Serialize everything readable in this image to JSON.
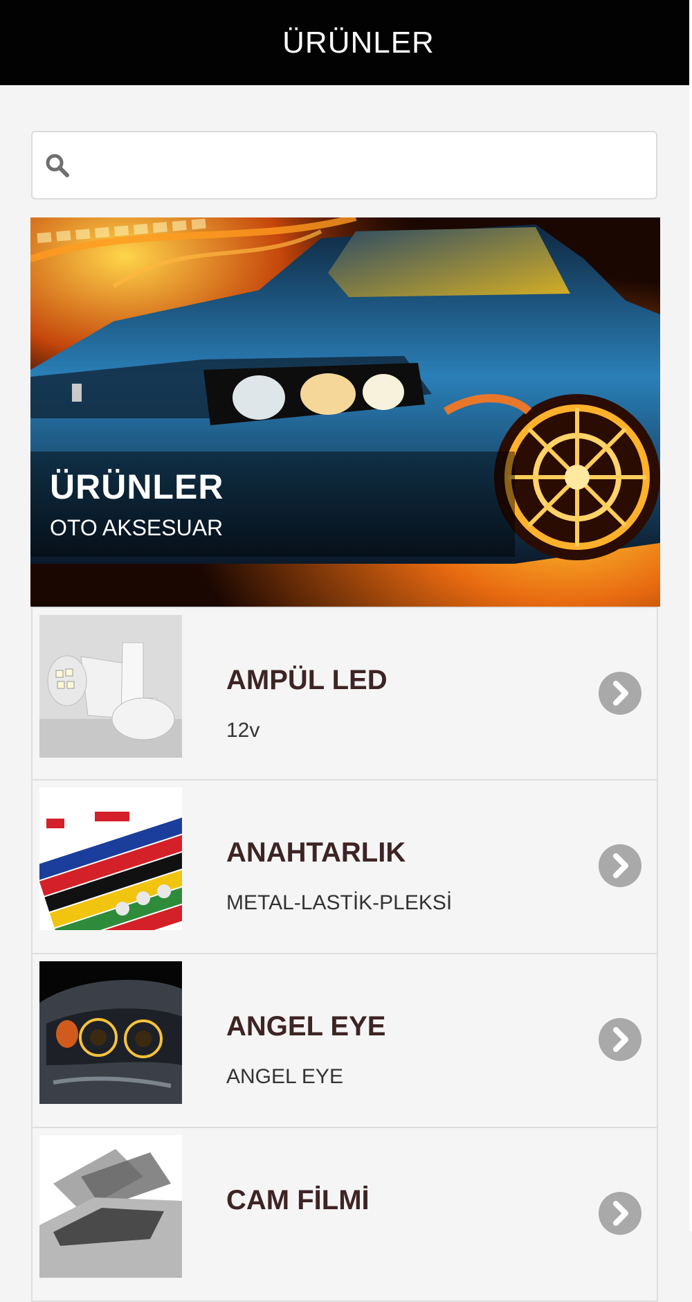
{
  "header": {
    "title": "ÜRÜNLER"
  },
  "search": {
    "placeholder": ""
  },
  "hero": {
    "title": "ÜRÜNLER",
    "subtitle": "OTO AKSESUAR"
  },
  "products": [
    {
      "name": "AMPÜL LED",
      "description": "12v",
      "image": "led-bulb-image"
    },
    {
      "name": "ANAHTARLIK",
      "description": "METAL-LASTİK-PLEKSİ",
      "image": "keychains-image"
    },
    {
      "name": "ANGEL EYE",
      "description": "ANGEL EYE",
      "image": "angel-eye-headlight-image"
    },
    {
      "name": "CAM FİLMİ",
      "description": "",
      "image": "window-film-image"
    }
  ],
  "colors": {
    "topbar": "#020202",
    "item_title": "#3e2424",
    "arrow_bg": "#a9a9a9"
  }
}
